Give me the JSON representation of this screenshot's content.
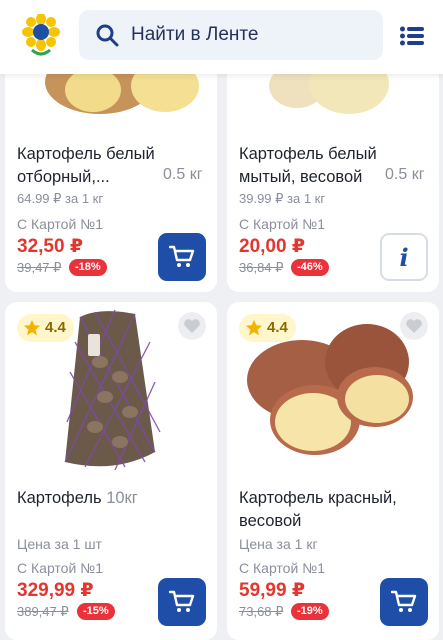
{
  "header": {
    "search_placeholder": "Найти в Ленте",
    "icons": [
      "lenta-sunflower-logo",
      "search-icon",
      "menu-list-icon"
    ]
  },
  "products": [
    {
      "title_line1": "Картофель белый",
      "title_line2": "отборный,...",
      "weight": "0.5 кг",
      "unit_price": "64.99 ₽ за 1 кг",
      "card_label": "С Картой №1",
      "price": "32,50 ₽",
      "old_price": "39,47 ₽",
      "discount": "-18%",
      "action": "cart"
    },
    {
      "title_line1": "Картофель белый",
      "title_line2": "мытый, весовой",
      "weight": "0.5 кг",
      "unit_price": "39.99 ₽ за 1 кг",
      "card_label": "С Картой №1",
      "price": "20,00 ₽",
      "old_price": "36,84 ₽",
      "discount": "-46%",
      "action": "info",
      "info_label": "i"
    },
    {
      "rating": "4.4",
      "title_main": "Картофель",
      "title_weight": "10кг",
      "unit_price": "Цена за 1 шт",
      "card_label": "С Картой №1",
      "price": "329,99 ₽",
      "old_price": "389,47 ₽",
      "discount": "-15%",
      "action": "cart"
    },
    {
      "rating": "4.4",
      "title_line1": "Картофель красный,",
      "title_line2": "весовой",
      "unit_price": "Цена за 1 кг",
      "card_label": "С Картой №1",
      "price": "59,99 ₽",
      "old_price": "73,68 ₽",
      "discount": "-19%",
      "action": "cart"
    }
  ],
  "colors": {
    "price_red": "#e4362e",
    "brand_blue": "#1f4ea8",
    "discount_badge": "#e9323a",
    "rating_bg": "#fff6cc"
  }
}
